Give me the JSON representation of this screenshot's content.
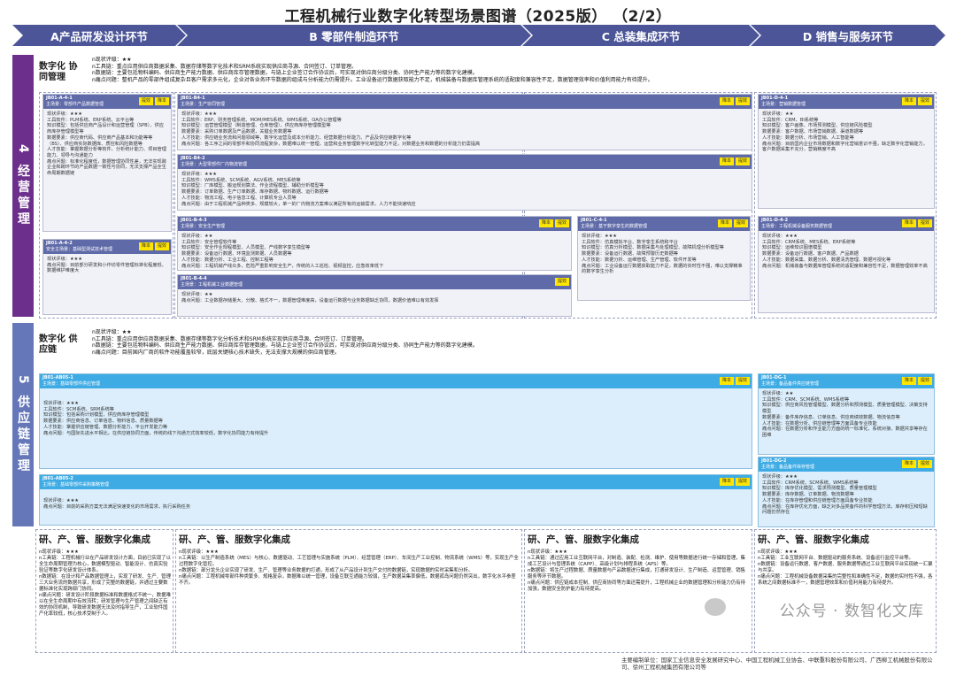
{
  "title": "工程机械行业数字化转型场景图谱（2025版） （2/2）",
  "phases": [
    {
      "label": "A产品研发设计环节"
    },
    {
      "label": "B 零部件制造环节"
    },
    {
      "label": "C 总装集成环节"
    },
    {
      "label": "D 销售与服务环节"
    }
  ],
  "bars": {
    "b4": "4 经营管理",
    "b5": "5 供应链管理"
  },
  "sections": {
    "s1": {
      "name": "数字化 协同管理",
      "lines": [
        "n现状评级：★★",
        "n工具链：重点应用供应商数据采集、数据存储等数字化技术和SRM系统实现供应商寻源、合同签订、订单管理。",
        "n数据链：主要包括物料编码、供应商生产能力数据、供应商库存管理数据，与链上企业签订合作协议后，可实现对供应商分级分类、协同生产能力等的数字化建模。",
        "n痛点问题：整机产品的零部件组成复杂且客户需求多元化，企业对各业务环节数据的组成与分析能力仍需提升。工业设备运行数据获取能力不足，机械装备与数据库管理系统的适配度和兼容性不足，数据管理效率和价值利用能力有待提升。"
      ]
    },
    "s2": {
      "name": "数字化 供应链",
      "lines": [
        "n现状评级：★★",
        "n工具链：重点应用供应商数据采集、数据存储等数字化分析技术和SRM系统实现供应商寻源、合同签订、订单管理。",
        "n数据链：主要包括物料编码、供应商生产能力数据、供应商库存管理数据，与链上企业签订合作协议后，可实现对供应商分级分类、协同生产能力等的数字化建模。",
        "n痛点问题：目前国内厂商的软件功能覆盖较窄，底层关键核心技术缺失，无法支撑大规模的供应商管理。"
      ]
    }
  },
  "cards": [
    {
      "code": "JB01-A-4-1",
      "scene": "主场景：零部件产品数据管理",
      "tags": [
        "提效",
        "降本"
      ],
      "body": [
        "现状评级：★★★",
        "工具软件：PLM系统、ERP系统、云平台等",
        "知识模型：包括供应商产品设计和运营管理（SPB）、供应商库存管理模型等",
        "数据要素：供应商代码、供应商产品基本和功能等等（BS）、供应商实际数据库、质控和风险数据等",
        "人才技能：掌握数据分析等软件、分析统计能力、项目管理能力、领导与沟通能力",
        "痛点问题：标准化程度低，数据管理协同性差，无法实现跨企业和跨环节的产品数据一致性与协同，无法支撑产品全生命周期数据链"
      ]
    },
    {
      "code": "JB01-A-4-2",
      "scene": "安全主场景：基础型测试技术管理",
      "tags": [
        "降本",
        "提效"
      ],
      "body": [
        "现状评级：★★★",
        "痛点问题：目前部分研发和小作坊零件管理标准化程度低、数据维护难度大"
      ]
    },
    {
      "code": "JB01-B4-1",
      "scene": "主场景：生产协同管理",
      "tags": [
        "降本",
        "提效"
      ],
      "body": [
        "现状评级：★★★",
        "工具软件：ERP、财务管理系统、MOM/MES系统、WMS系统、OA办公管理等",
        "知识模型：运营管理模型（制造管理、仓库管理）、供应商库存管理模型等",
        "数据要素：采购订单数据及产品数据，关键业务数据等",
        "人才技能：供应链业务流和问题领域等，数字化运营及成本分析能力、经营数据分析能力、产品及供应链数字化等",
        "痛点问题：各工序之间的零部件和协同流程复杂，数据难以统一管理，运营和业务管理数字化转型能力不足，对数据业务和数据的分析能力仍需提高"
      ]
    },
    {
      "code": "JB01-B4-2",
      "scene": "主场景：大型零部件厂内物流管理",
      "tags": [
        "降本",
        "提效"
      ],
      "body": [
        "现状评级：★★★",
        "工具软件：WMS系统、SCM系统、AGV系统、MES系统等",
        "知识模型：厂库模型、搬运规划算法、作业流程模型、辅助分析模型等",
        "数据要素：订单数据、生产订单数据、库存数据、物料数据、运行数据等",
        "人才技能：物流工程、电子信息工程、计算机专业人员等",
        "痛点问题：由于工程机械产品种类多、规模较大，单一的厂内物流方案难以满足所有的运输需求，人力不能快速响应"
      ]
    },
    {
      "code": "JB01-B-4-3",
      "scene": "主场景：安全生产管理",
      "tags": [
        "降本",
        "提效"
      ],
      "body": [
        "现状评级：★★",
        "工具软件：安全管理软件等",
        "知识模型：安全作业规程模型、人员模型、产线数字孪生模型等",
        "数据要素：设备运行数据、环境监测数据、人员数据等",
        "人才技能：数据分析、工业工程、控制工程等",
        "痛点问题：工程机械产线众多，危险严重影响安全生产，传统的人工巡检、视频监控，应急效率低下"
      ]
    },
    {
      "code": "JB01-B-4-4",
      "scene": "主场景：工程机械工业数据管理",
      "tags": [
        "提效"
      ],
      "body": [
        "现状评级：★★",
        "痛点问题：工业数据存储量大、分散、格式不一，数据管理难度高，设备运行数据与业务数据缺乏协同，数据价值难以有效发挥"
      ]
    },
    {
      "code": "JB01-C-4-1",
      "scene": "主场景：基于数字孪生的数据管理",
      "tags": [
        "降本",
        "提效"
      ],
      "body": [
        "现状评级：★★★",
        "工具软件：仿真模拟平台、数字孪生系统和平台",
        "知识模型：仿真分析模型、数据采集与处理模型、故障机理分析模型等",
        "数据要素：设备运行数据、故障预警历史数据等",
        "人才技能：数据分析、运维管理、生产管理、软件开发等",
        "痛点问题：工业设备运行数据获取能力不足，数据的实时性不强，难以支撑精准的数字孪生分析"
      ]
    },
    {
      "code": "JB01-D-4-1",
      "scene": "主场景：营销数据管理",
      "tags": [
        "降本",
        "提效"
      ],
      "body": [
        "现状评级：★★",
        "工具软件：CRM、BI系统等",
        "知识模型：客户画像、市场预测模型、供应链风险模型",
        "数据要素：客户数据、市场营销数据、渠道数据等",
        "人才技能：数据分析、市场营销、人工智能等",
        "痛点问题：目前国内企业市场数据和数字化营销意识不强，缺乏数字化营销能力，客户数据采集不充分，营销精度不高"
      ]
    },
    {
      "code": "JB01-D-4-2",
      "scene": "主场景：工程机械设备服务数据管理",
      "tags": [
        "降本",
        "提效"
      ],
      "body": [
        "现状评级：★★★",
        "工具软件：CRM系统、MES系统、ERP系统等",
        "知识模型：运维知识图谱模型",
        "数据要素：设备运行数据、客户数据、产品数据",
        "人才技能：数据采集、数据分析、数据清洗管理、数据可视化等",
        "痛点问题：机械装备与数据库管理系统的适配度和兼容性不足，数据管理效率不高"
      ]
    },
    {
      "code": "JB01-AB05-1",
      "scene": "主场景：基础零部件供应管理",
      "tags": [
        "降本",
        "提效"
      ],
      "body": [
        "现状评级：★★★",
        "工具软件：SCM系统、SRM系统等",
        "知识模型：包括采购计划模型、供应商库存管理模型",
        "数据要素：供应商信息、订单信息、物料信息、质量数据等",
        "人才技能：掌握供应链管理、数据分析能力、平台开发能力等",
        "痛点问题：与国际先进水平相比，在供应链协同方面，传统的线下沟通方式效率较低，数字化协同能力有待提升"
      ]
    },
    {
      "code": "JB01-AB05-2",
      "scene": "主场景：基础零部件采购策略管理",
      "tags": [
        "降本",
        "提效"
      ],
      "body": [
        "现状评级：★★★",
        "痛点问题：目前的采购方案无法满足快速变化的市场需求，执行采购任务"
      ]
    },
    {
      "code": "JB01-DG-1",
      "scene": "主场景：备品备件供应链管理",
      "tags": [
        "降本",
        "提效"
      ],
      "body": [
        "现状评级：★★",
        "工具软件：CRM、SCM系统、WMS系统等",
        "知识模型：供应商风险管理模型、数据分析和预测模型、质量管理模型、决策支持模型",
        "数据要素：备件库存信息、订单信息、供应商绩效数据、物流信息等",
        "人才技能：在数据分析、供应链管理等方面具备专业技能",
        "痛点问题：在数据分析和作业能力方面的统一标准化、系统对接、数据共享等存在困难"
      ]
    },
    {
      "code": "JB01-DG-2",
      "scene": "主场景：备品备件库存管理",
      "tags": [
        "降本",
        "提效"
      ],
      "body": [
        "现状评级：★★★",
        "工具软件：CRM系统、SCM系统、WMS系统等",
        "知识模型：库存优化模型、需求预测模型、质量管理模型",
        "数据要素：库存数据、订单数据、物流数据等",
        "人才技能：在库存管理和供应链管理方面具备专业技能",
        "痛点问题：在库存优化方面，缺乏对多品类备件的科学管理方法，库存积压和短缺问题仍然存在"
      ]
    }
  ],
  "bottom": [
    {
      "heading": "研、产、管、服数字化集成",
      "lines": [
        "n现状评级：★★★",
        "n工具链：工程机械行业在产品研发设计方面，目前已实现了以全生命周期管理为核心，数据模型驱动、智能设计、仿真实验验证等数字化研发设计体系。",
        "n数据链：在设计和产品数据管理上，实现了研发、生产、管理三大业务流的数据共享，形成了完整的数据链，并通过主要数据标准化实现跨部门协同。",
        "n痛点问题：研发设计阶段数据标准和数据格式不统一，数据难以在全生命周期中有效流转；研发管理与生产管理之间缺乏有效的协同机制，导致研发数据无法及时指导生产，工业软件国产化率较低，核心技术受制于人。"
      ]
    },
    {
      "heading": "研、产、管、服数字化集成",
      "lines": [
        "n现状评级：★★★",
        "n工具链：以生产制造系统（MES）与核心、数据驱动、工艺管理与实施系统（PLM）、经营管理（ERP）、车间生产工业控制、物流系统（WMS）等，实现生产全过程数字化管控。",
        "n数据链：部分龙头企业实现了研发、生产、管理等业务数据的打通，形成了从产品设计到生产交付的数据链，实现数据的实时采集和分析。",
        "n痛点问题：工程机械零部件种类繁多、规格复杂，数据难以统一管理，设备互联互通能力较弱，生产数据采集率偏低，数据孤岛问题仍然突出，数字化水平参差不齐。"
      ]
    },
    {
      "heading": "研、产、管、服数字化集成",
      "lines": [
        "n现状评级：★★★",
        "n工具链：通过应用工业互联网平台，对制造、装配、检测、维护、使用等数据进行统一存储和管理，集成工艺设计与管理系统（CAPP）、高级计划与排程系统（APS）等。",
        "n数据链：将生产过程数据、质量数据与产品数据进行集成，打通研发设计、生产制造、运营管理、销售服务等环节数据。",
        "n痛点问题：供应链成本控制、供应商协同等方面还需提升，工程机械企业的数据管理和分析能力仍有待加强，数据安全防护能力有待提高。"
      ]
    },
    {
      "heading": "研、产、管、服数字化集成",
      "lines": [
        "n现状评级：★★★",
        "n工具链：工业互联网平台、数据驱动的服务系统、设备运行监控平台等。",
        "n数据链：设备运行数据、客户数据、服务数据等通过工业互联网平台实现统一汇聚与共享。",
        "n痛点问题：工程机械设备数据采集的完整性和准确性不足，数据的实时性不强，各系统之间数据标准不一，数据管理效率和价值利用能力有待提升。"
      ]
    }
  ],
  "watermark": "公众号 · 数智化文库",
  "footer": "主要编制单位：国家工业信息安全发展研究中心、中国工程机械工业协会、中联重科股份有限公司、广西柳工机械股份有限公司、徐州工程机械集团有限公司等",
  "colors": {
    "phase": "#4b5597",
    "bar4": "#6d2f8c",
    "bar5": "#6577b8",
    "card_header": "#5f6aa8",
    "cyan_header": "#3eabe4",
    "tag": "#ffe600"
  }
}
